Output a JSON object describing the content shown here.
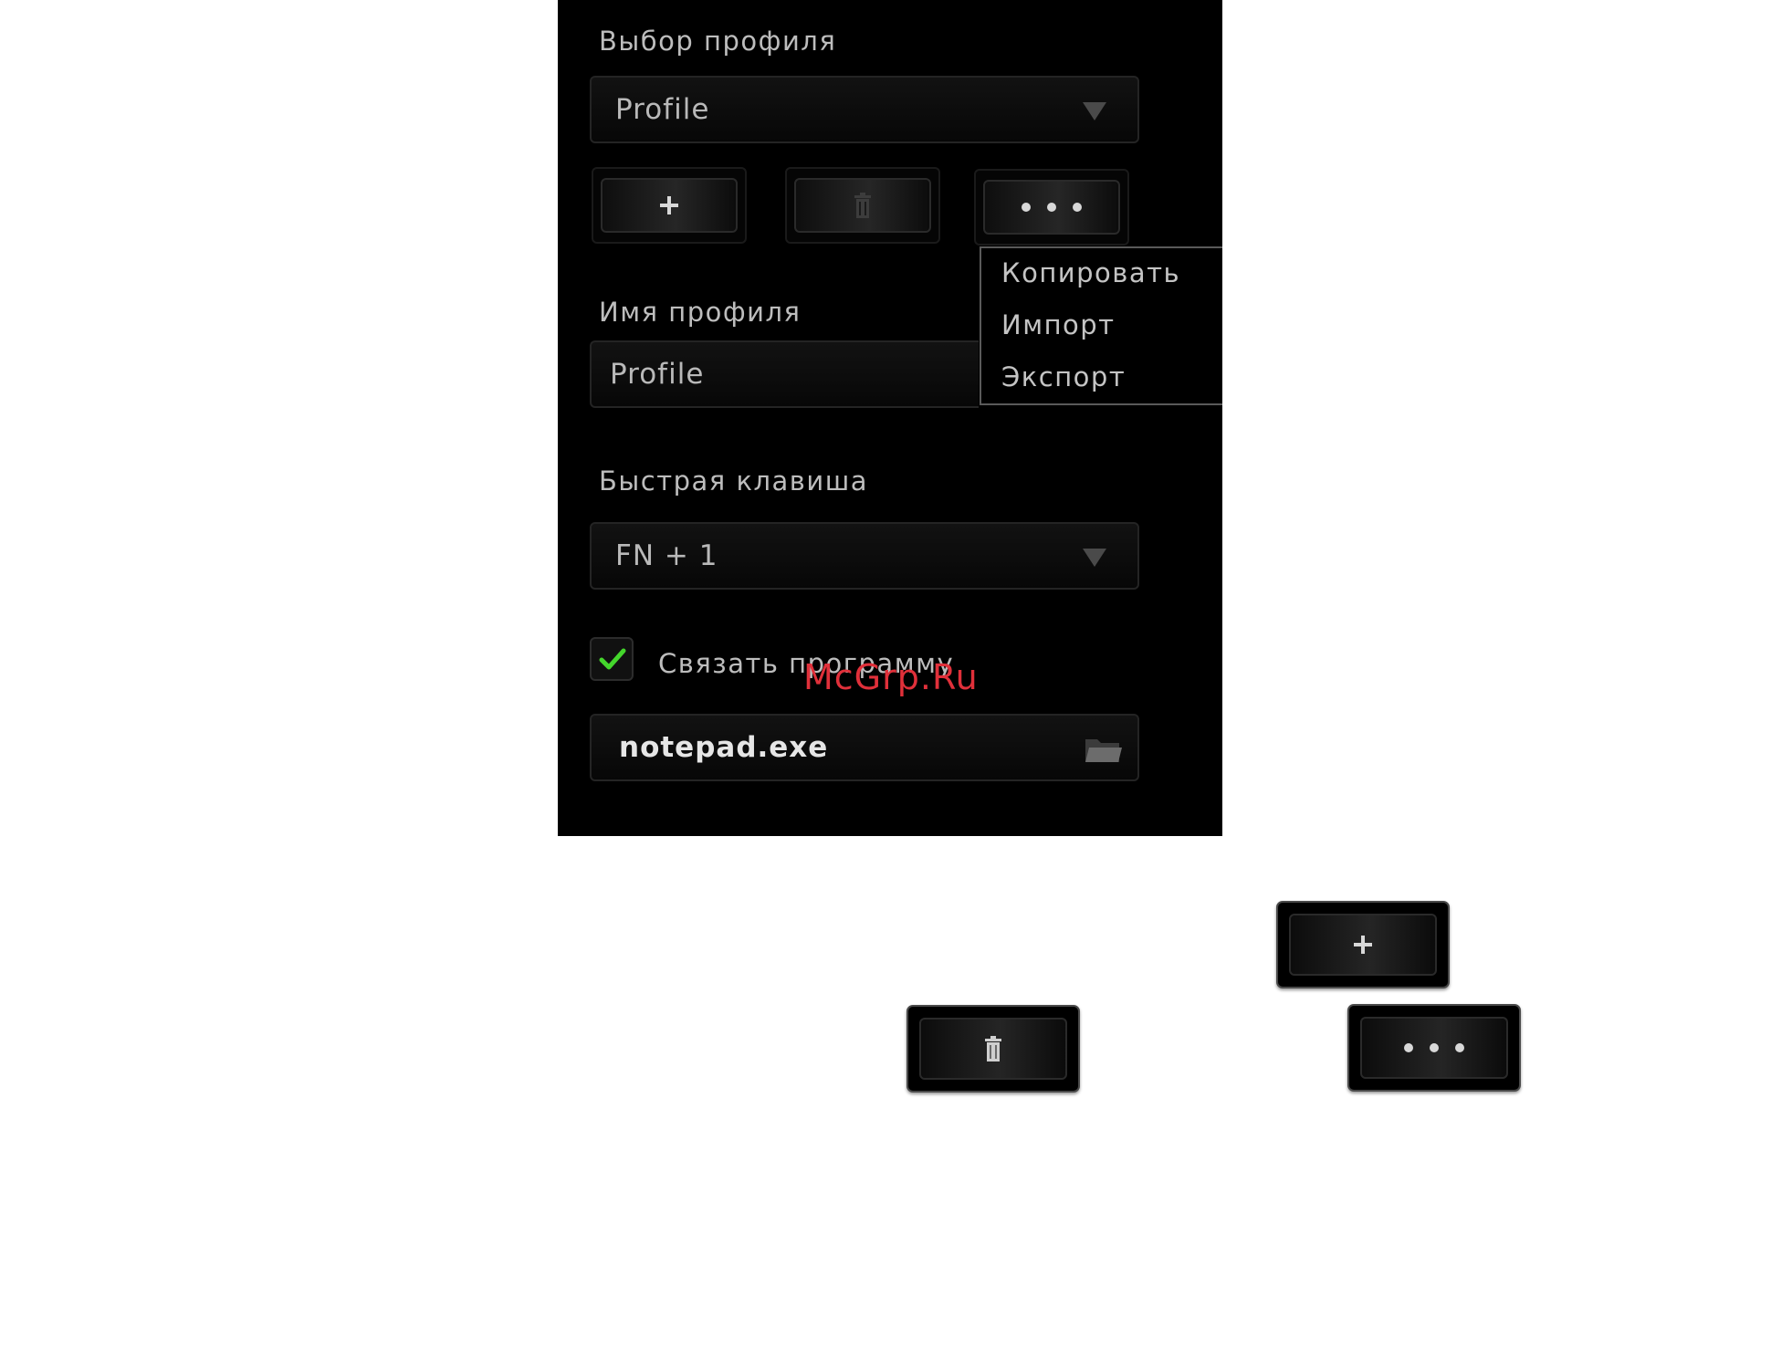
{
  "panel": {
    "profile_select_label": "Выбор профиля",
    "profile_select_value": "Profile",
    "profile_name_label": "Имя профиля",
    "profile_name_value": "Profile",
    "hotkey_label": "Быстрая клавиша",
    "hotkey_value": "FN + 1",
    "link_program_label": "Связать программу",
    "link_program_checked": true,
    "program_value": "notepad.exe"
  },
  "menu": {
    "items": [
      "Копировать",
      "Импорт",
      "Экспорт"
    ]
  },
  "icons": {
    "add": "plus-icon",
    "delete": "trash-icon",
    "more": "more-dots-icon",
    "dropdown": "caret-down-icon",
    "folder": "folder-icon",
    "check": "checkmark-icon"
  },
  "colors": {
    "panel_bg": "#000000",
    "text": "#bdbdbd",
    "check": "#44d62c",
    "watermark": "#e0303a"
  },
  "watermark": "McGrp.Ru"
}
